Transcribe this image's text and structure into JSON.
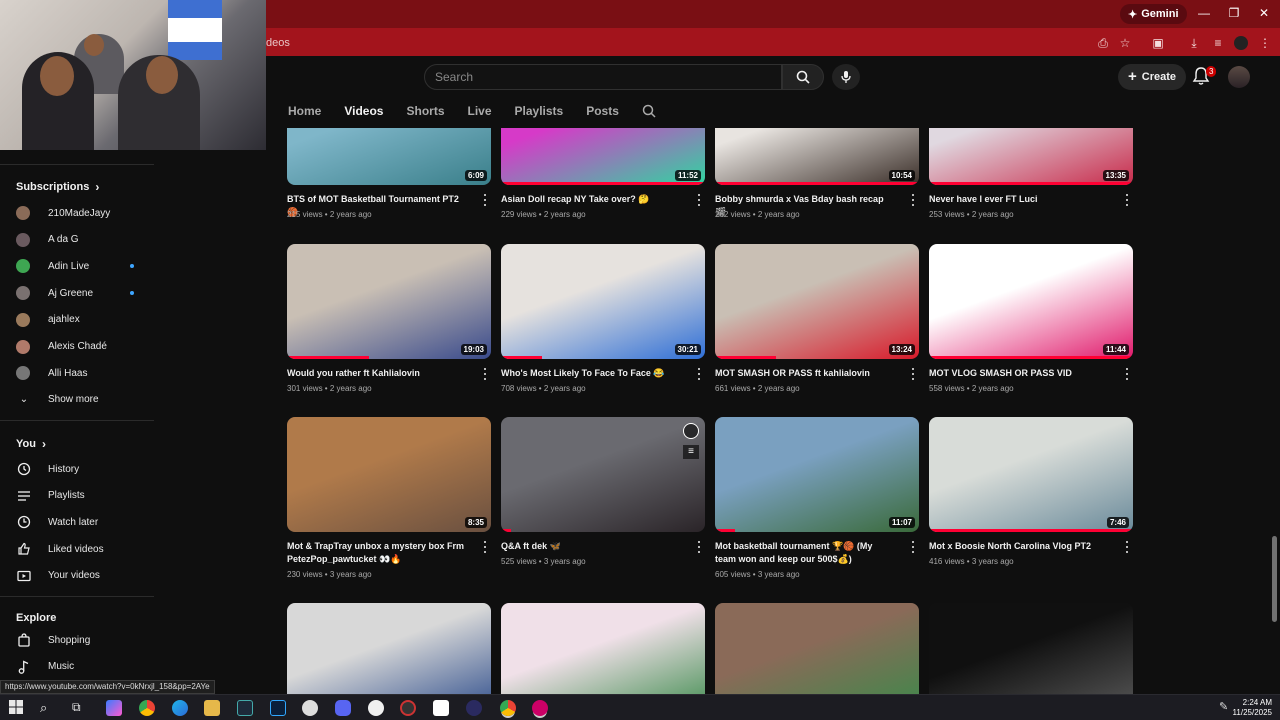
{
  "browser": {
    "url_fragment": "deos",
    "gemini_label": "Gemini",
    "status_url": "https://www.youtube.com/watch?v=0kNrxjl_158&pp=2AYe"
  },
  "header": {
    "search_placeholder": "Search",
    "create_label": "Create",
    "notification_count": "3"
  },
  "channel_tabs": [
    "Home",
    "Videos",
    "Shorts",
    "Live",
    "Playlists",
    "Posts"
  ],
  "active_tab": "Videos",
  "sidebar": {
    "subscriptions_label": "Subscriptions",
    "subscriptions": [
      {
        "name": "210MadeJayy",
        "color": "#8a6b58",
        "live": false
      },
      {
        "name": "A da G",
        "color": "#6a5a5f",
        "live": false
      },
      {
        "name": "Adin Live",
        "color": "#3ea652",
        "live": true
      },
      {
        "name": "Aj Greene",
        "color": "#7a7170",
        "live": true
      },
      {
        "name": "ajahlex",
        "color": "#9a7a5c",
        "live": false
      },
      {
        "name": "Alexis Chadé",
        "color": "#b07a6a",
        "live": false
      },
      {
        "name": "Alli Haas",
        "color": "#777777",
        "live": false
      }
    ],
    "show_more_label": "Show more",
    "you_label": "You",
    "you_items": [
      "History",
      "Playlists",
      "Watch later",
      "Liked videos",
      "Your videos"
    ],
    "explore_label": "Explore",
    "explore_items": [
      "Shopping",
      "Music"
    ]
  },
  "videos": [
    {
      "title": "BTS of MOT Basketball Tournament PT2 🏀",
      "meta": "215 views • 2 years ago",
      "duration": "6:09",
      "progress": 0,
      "colors": [
        "#7fb6c9",
        "#3a7f8a"
      ]
    },
    {
      "title": "Asian Doll recap NY Take over? 🤔",
      "meta": "229 views • 2 years ago",
      "duration": "11:52",
      "progress": 1,
      "colors": [
        "#d63ac8",
        "#2fd6a0"
      ]
    },
    {
      "title": "Bobby shmurda x Vas Bday bash recap 🎬",
      "meta": "262 views • 2 years ago",
      "duration": "10:54",
      "progress": 1,
      "colors": [
        "#e8e4e0",
        "#3a2e28"
      ]
    },
    {
      "title": "Never have I ever FT Luci",
      "meta": "253 views • 2 years ago",
      "duration": "13:35",
      "progress": 1,
      "colors": [
        "#e0d8e0",
        "#c82a4a"
      ]
    },
    {
      "title": "Would you rather ft Kahlialovin",
      "meta": "301 views • 2 years ago",
      "duration": "19:03",
      "progress": 0.4,
      "colors": [
        "#c9bfb4",
        "#3a4b8c"
      ]
    },
    {
      "title": "Who's Most Likely To Face To Face 😂",
      "meta": "708 views • 2 years ago",
      "duration": "30:21",
      "progress": 0.2,
      "colors": [
        "#e6e2de",
        "#2f6fd6"
      ]
    },
    {
      "title": "MOT SMASH OR PASS ft kahlialovin",
      "meta": "661 views • 2 years ago",
      "duration": "13:24",
      "progress": 0.3,
      "colors": [
        "#c9bfb4",
        "#d81a2a"
      ]
    },
    {
      "title": "MOT VLOG SMASH OR PASS VID",
      "meta": "558 views • 2 years ago",
      "duration": "11:44",
      "progress": 1,
      "colors": [
        "#ffffff",
        "#e0186a"
      ]
    },
    {
      "title": "Mot & TrapTray unbox a mystery box Frm PetezPop_pawtucket 👀🔥",
      "meta": "230 views • 3 years ago",
      "duration": "8:35",
      "progress": 0,
      "colors": [
        "#b07a4a",
        "#6a5040"
      ]
    },
    {
      "title": "Q&A ft dek 🦋",
      "meta": "525 views • 3 years ago",
      "duration": "",
      "progress": 0.05,
      "colors": [
        "#6a6a70",
        "#2a2428"
      ]
    },
    {
      "title": "Mot basketball tournament 🏆🏀 (My team won and keep our 500$💰)",
      "meta": "605 views • 3 years ago",
      "duration": "11:07",
      "progress": 0.1,
      "colors": [
        "#7aa0c0",
        "#3a6a3a"
      ]
    },
    {
      "title": "Mot x Boosie North Carolina Vlog PT2",
      "meta": "416 views • 3 years ago",
      "duration": "7:46",
      "progress": 1,
      "colors": [
        "#d8dcd8",
        "#6a8a9a"
      ]
    },
    {
      "title": "",
      "meta": "",
      "duration": "",
      "progress": 0,
      "colors": [
        "#d8d8d8",
        "#2a4a8a"
      ]
    },
    {
      "title": "",
      "meta": "",
      "duration": "",
      "progress": 0,
      "colors": [
        "#f0e0e8",
        "#3a8a4a"
      ]
    },
    {
      "title": "",
      "meta": "",
      "duration": "",
      "progress": 0,
      "colors": [
        "#8a6a58",
        "#3a8a4a"
      ]
    },
    {
      "title": "",
      "meta": "",
      "duration": "",
      "progress": 0,
      "colors": [
        "#101010",
        "#5a5a5a"
      ]
    }
  ],
  "q_and_a_overlays": [
    "clock-icon",
    "queue-icon"
  ],
  "taskbar": {
    "time": "2:24 AM",
    "date": "11/25/2025"
  },
  "colors": {
    "browser_titlebar": "#7a0f14",
    "browser_toolbar": "#a3141c",
    "page_bg": "#0f0f0f",
    "progress_red": "#ff0033"
  }
}
